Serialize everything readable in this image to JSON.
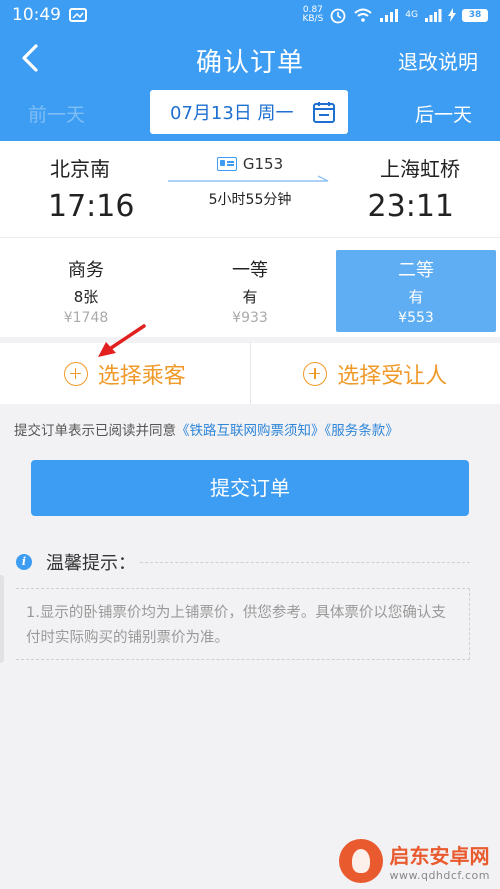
{
  "status_bar": {
    "time": "10:49",
    "net_speed": "0.87",
    "net_unit": "KB/S",
    "network": "4G",
    "battery": "38"
  },
  "nav": {
    "title": "确认订单",
    "right_link": "退改说明"
  },
  "date_bar": {
    "prev": "前一天",
    "date": "07月13日 周一",
    "next": "后一天"
  },
  "train": {
    "from": "北京南",
    "to": "上海虹桥",
    "depart_time": "17:16",
    "arrive_time": "23:11",
    "train_no": "G153",
    "duration": "5小时55分钟"
  },
  "seats": [
    {
      "name": "商务",
      "count": "8张",
      "price": "¥1748",
      "selected": false
    },
    {
      "name": "一等",
      "count": "有",
      "price": "¥933",
      "selected": false
    },
    {
      "name": "二等",
      "count": "有",
      "price": "¥553",
      "selected": true
    }
  ],
  "choose": {
    "passenger": "选择乘客",
    "beneficiary": "选择受让人"
  },
  "agreement": {
    "prefix": "提交订单表示已阅读并同意",
    "link1": "《铁路互联网购票须知》",
    "link2": "《服务条款》"
  },
  "submit_label": "提交订单",
  "tip": {
    "title": "温馨提示：",
    "body": "1.显示的卧铺票价均为上铺票价，供您参考。具体票价以您确认支付时实际购买的铺别票价为准。"
  },
  "watermark": {
    "name": "启东安卓网",
    "url": "www.qdhdcf.com"
  },
  "colors": {
    "primary": "#3d9df2",
    "accent": "#f09a2a",
    "link": "#2f86d9"
  }
}
